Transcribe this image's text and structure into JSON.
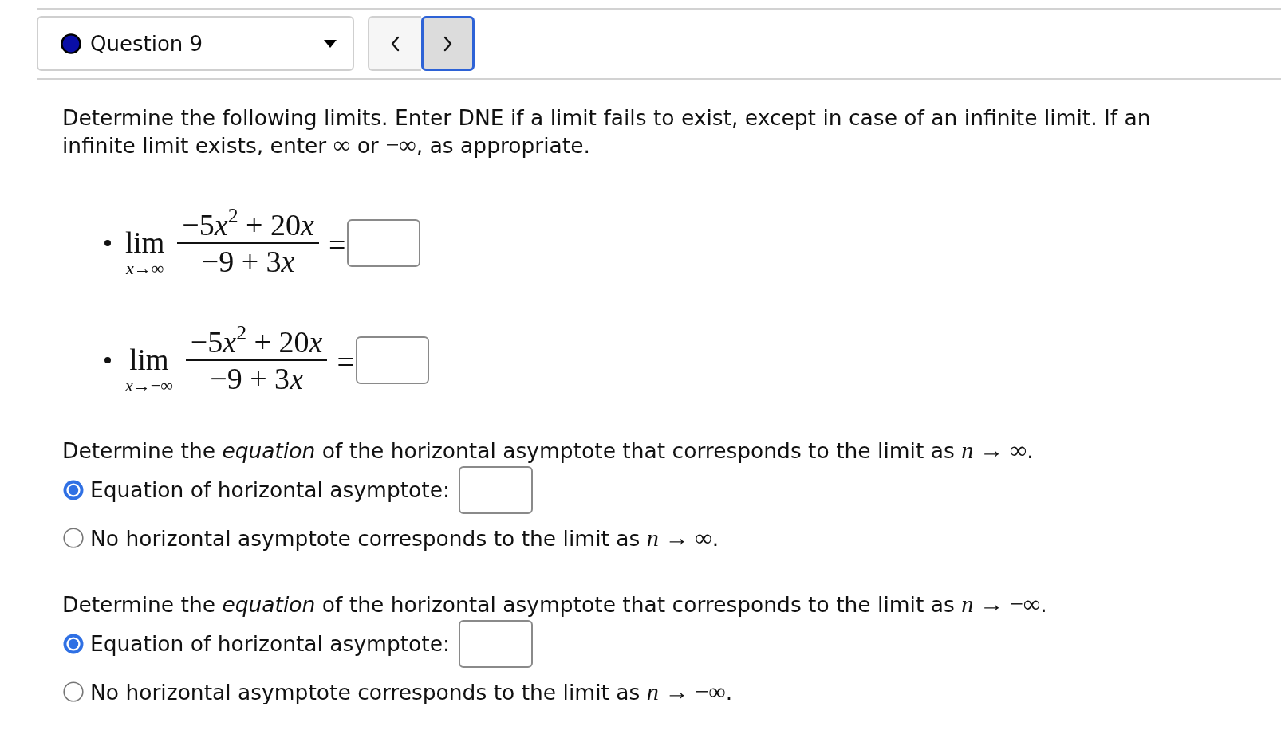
{
  "question_select": {
    "label": "Question 9"
  },
  "nav_buttons": [
    {
      "kind": "previous",
      "focused": false
    },
    {
      "kind": "next",
      "focused": true
    }
  ],
  "intro": [
    {
      "kind": "text",
      "text": "Determine the following limits. Enter DNE if a limit fails to exist, except in case of an infinite limit. If an infinite limit exists, enter "
    },
    {
      "kind": "math",
      "text": "∞"
    },
    {
      "kind": "text",
      "text": " or "
    },
    {
      "kind": "math",
      "text": "−∞"
    },
    {
      "kind": "text",
      "text": ", as appropriate."
    }
  ],
  "limits": [
    {
      "operator": "lim",
      "approach": "*x*→∞",
      "numerator": [
        {
          "kind": "plain",
          "text": "−5"
        },
        {
          "kind": "var",
          "text": "x"
        },
        {
          "kind": "sup",
          "text": "2"
        },
        {
          "kind": "plain",
          "text": " + 20"
        },
        {
          "kind": "var",
          "text": "x"
        }
      ],
      "denominator": [
        {
          "kind": "plain",
          "text": "−9 + 3"
        },
        {
          "kind": "var",
          "text": "x"
        }
      ],
      "relation": "="
    },
    {
      "operator": "lim",
      "approach": "*x*→−∞",
      "numerator": [
        {
          "kind": "plain",
          "text": "−5"
        },
        {
          "kind": "var",
          "text": "x"
        },
        {
          "kind": "sup",
          "text": "2"
        },
        {
          "kind": "plain",
          "text": " + 20"
        },
        {
          "kind": "var",
          "text": "x"
        }
      ],
      "denominator": [
        {
          "kind": "plain",
          "text": "−9 + 3"
        },
        {
          "kind": "var",
          "text": "x"
        }
      ],
      "relation": "="
    }
  ],
  "asymptote_questions": [
    {
      "prompt": [
        {
          "kind": "text",
          "text": "Determine the *equation* of the horizontal asymptote that corresponds to the limit as "
        },
        {
          "kind": "math",
          "text": "*n* → ∞"
        },
        {
          "kind": "text",
          "text": "."
        }
      ],
      "options": [
        {
          "kind": "equation",
          "selected": true,
          "label": [
            {
              "kind": "text",
              "text": "Equation of horizontal asymptote:"
            }
          ]
        },
        {
          "kind": "none",
          "selected": false,
          "label": [
            {
              "kind": "text",
              "text": "No horizontal asymptote corresponds to the limit as "
            },
            {
              "kind": "math",
              "text": "*n* → ∞"
            },
            {
              "kind": "text",
              "text": "."
            }
          ]
        }
      ]
    },
    {
      "prompt": [
        {
          "kind": "text",
          "text": "Determine the *equation* of the horizontal asymptote that corresponds to the limit as "
        },
        {
          "kind": "math",
          "text": "*n* → −∞"
        },
        {
          "kind": "text",
          "text": "."
        }
      ],
      "options": [
        {
          "kind": "equation",
          "selected": true,
          "label": [
            {
              "kind": "text",
              "text": "Equation of horizontal asymptote:"
            }
          ]
        },
        {
          "kind": "none",
          "selected": false,
          "label": [
            {
              "kind": "text",
              "text": "No horizontal asymptote corresponds to the limit as "
            },
            {
              "kind": "math",
              "text": "*n* → −∞"
            },
            {
              "kind": "text",
              "text": "."
            }
          ]
        }
      ]
    }
  ]
}
